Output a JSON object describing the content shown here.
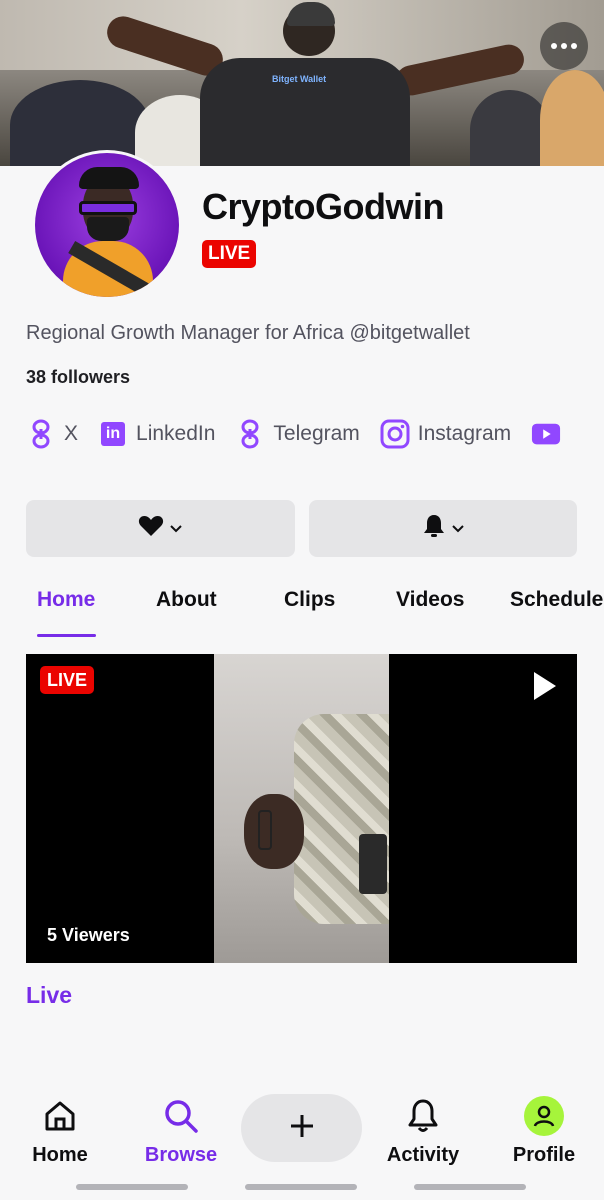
{
  "header": {
    "more_icon": "more-horizontal-icon"
  },
  "channel": {
    "name": "CryptoGodwin",
    "live_label": "LIVE",
    "bio": "Regional Growth Manager for Africa @bitgetwallet",
    "followers": "38 followers"
  },
  "socials": [
    {
      "label": "X",
      "icon": "link-icon"
    },
    {
      "label": "LinkedIn",
      "icon": "linkedin-icon"
    },
    {
      "label": "Telegram",
      "icon": "link-icon"
    },
    {
      "label": "Instagram",
      "icon": "instagram-icon"
    },
    {
      "label": "",
      "icon": "youtube-icon"
    }
  ],
  "actions": {
    "follow_icon": "heart-icon",
    "notify_icon": "bell-icon"
  },
  "tabs": [
    {
      "label": "Home",
      "active": true
    },
    {
      "label": "About",
      "active": false
    },
    {
      "label": "Clips",
      "active": false
    },
    {
      "label": "Videos",
      "active": false
    },
    {
      "label": "Schedule",
      "active": false
    }
  ],
  "player": {
    "live_label": "LIVE",
    "viewers": "5 Viewers"
  },
  "section": {
    "live_title": "Live"
  },
  "bottom_nav": [
    {
      "label": "Home",
      "icon": "home-icon",
      "active": false
    },
    {
      "label": "Browse",
      "icon": "search-icon",
      "active": true
    },
    {
      "label": "",
      "icon": "plus-icon",
      "active": false
    },
    {
      "label": "Activity",
      "icon": "bell-icon",
      "active": false
    },
    {
      "label": "Profile",
      "icon": "profile-icon",
      "active": false
    }
  ],
  "colors": {
    "accent": "#772ce8",
    "live_red": "#eb0400",
    "icon_purple": "#9147ff",
    "profile_green": "#a6f43b"
  }
}
